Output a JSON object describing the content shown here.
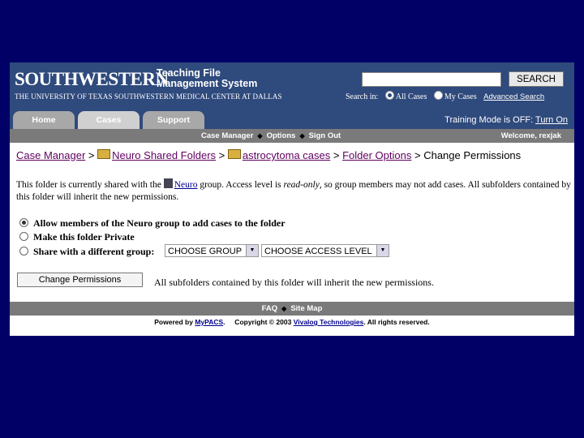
{
  "header": {
    "logo": "SOUTHWESTERN",
    "app_title_line1": "Teaching File",
    "app_title_line2": "Management System",
    "institution": "THE UNIVERSITY OF TEXAS SOUTHWESTERN MEDICAL CENTER AT DALLAS",
    "search_value": "",
    "search_button": "SEARCH",
    "search_in_label": "Search in:",
    "scope_all": "All Cases",
    "scope_mine": "My Cases",
    "advanced_search": "Advanced Search",
    "colors": {
      "header_bg": "#2f4a7c",
      "page_bg": "#000066"
    }
  },
  "tabs": [
    {
      "label": "Home"
    },
    {
      "label": "Cases",
      "active": true
    },
    {
      "label": "Support"
    }
  ],
  "training": {
    "text": "Training Mode is OFF:",
    "link": "Turn On"
  },
  "subnav": {
    "items": [
      "Case Manager",
      "Options",
      "Sign Out"
    ],
    "welcome": "Welcome, rexjak"
  },
  "breadcrumb": {
    "items": [
      "Case Manager",
      "Neuro Shared Folders",
      "astrocytoma cases",
      "Folder Options"
    ],
    "current": "Change Permissions",
    "separator": ">"
  },
  "info": {
    "part1": "This folder is currently shared with the",
    "group_link": "Neuro",
    "part2": "group.  Access level is",
    "access_level": "read-only",
    "part3": ", so group members may not add cases. All subfolders contained by this folder will inherit the new permissions."
  },
  "options": [
    {
      "label": "Allow members of the Neuro group to add cases to the folder",
      "selected": true
    },
    {
      "label": "Make this folder Private",
      "selected": false
    },
    {
      "label": "Share with a different group:",
      "selected": false
    }
  ],
  "selects": {
    "group": "CHOOSE GROUP",
    "access": "CHOOSE ACCESS LEVEL"
  },
  "change_button": "Change Permissions",
  "inherit_note": "All subfolders contained by this folder will inherit the new permissions.",
  "footer": {
    "links": [
      "FAQ",
      "Site Map"
    ],
    "powered_prefix": "Powered by",
    "powered_link": "MyPACS",
    "copyright": ".     Copyright © 2003",
    "company_link": "Vivalog Technologies",
    "rights": ". All rights reserved."
  }
}
